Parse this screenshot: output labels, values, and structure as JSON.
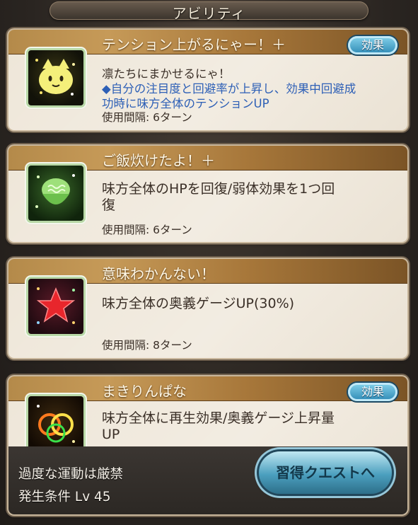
{
  "header": {
    "title": "アビリティ"
  },
  "abilities": [
    {
      "name": "テンション上がるにゃー！＋",
      "has_effect_button": true,
      "effect_label": "効果",
      "desc_lines": [
        "凛たちにまかせるにゃ！",
        "◆自分の注目度と回避率が上昇し、効果中回避成",
        "功時に味方全体のテンションUP"
      ],
      "interval": "使用間隔: 6ターン",
      "icon": "cat-face-icon"
    },
    {
      "name": "ご飯炊けたよ！＋",
      "has_effect_button": false,
      "desc_lines": [
        "味方全体のHPを回復/弱体効果を1つ回",
        "復"
      ],
      "interval": "使用間隔: 6ターン",
      "icon": "rice-bowl-icon"
    },
    {
      "name": "意味わかんない！",
      "has_effect_button": false,
      "desc_lines": [
        "味方全体の奥義ゲージUP(30%)"
      ],
      "interval": "使用間隔: 8ターン",
      "icon": "star-icon"
    },
    {
      "name": "まきりんぱな",
      "has_effect_button": true,
      "effect_label": "効果",
      "desc_lines": [
        "味方全体に再生効果/奥義ゲージ上昇量",
        "UP"
      ],
      "condition_name": "過度な運動は厳禁",
      "condition_level": "発生条件 Lv 45",
      "quest_button": "習得クエストへ",
      "icon": "rings-icon"
    }
  ],
  "colors": {
    "title_bar": "#b48a4a",
    "blue_text": "#2d5fb6",
    "effect_button": "#2c88b4"
  }
}
